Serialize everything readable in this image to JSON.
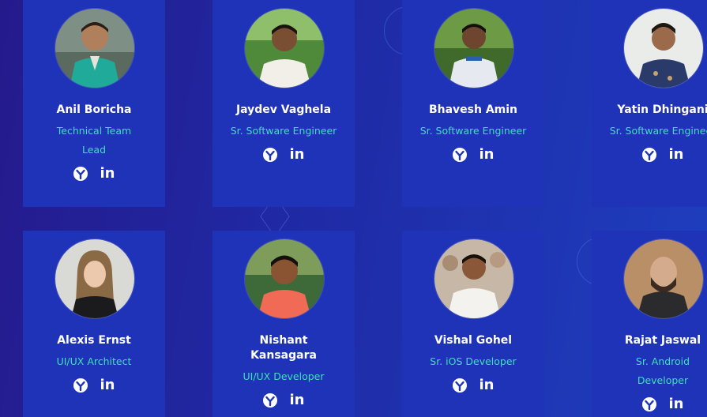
{
  "team": [
    {
      "name": "Anil Boricha",
      "role": "Technical Team Lead",
      "avatar": "portrait-man-teal-vest"
    },
    {
      "name": "Jaydev Vaghela",
      "role": "Sr. Software Engineer",
      "avatar": "portrait-man-white-shirt"
    },
    {
      "name": "Bhavesh Amin",
      "role": "Sr. Software Engineer",
      "avatar": "portrait-man-polo"
    },
    {
      "name": "Yatin Dhingani",
      "role": "Sr. Software Engineer",
      "avatar": "portrait-man-patterned-shirt"
    },
    {
      "name": "Alexis Ernst",
      "role": "UI/UX Architect",
      "avatar": "portrait-woman-blonde"
    },
    {
      "name": "Nishant Kansagara",
      "role": "UI/UX Developer",
      "avatar": "portrait-man-orange-shirt"
    },
    {
      "name": "Vishal Gohel",
      "role": "Sr. iOS Developer",
      "avatar": "portrait-man-white-shirt-crowd"
    },
    {
      "name": "Rajat Jaswal",
      "role": "Sr. Android Developer",
      "avatar": "portrait-man-beard"
    }
  ],
  "social": {
    "profile_icon": "upwork-icon",
    "linkedin_icon": "linkedin-icon",
    "linkedin_label": "in"
  },
  "colors": {
    "card_bg": "#1f33b8",
    "name": "#ffffff",
    "role": "#3fe0b8"
  }
}
